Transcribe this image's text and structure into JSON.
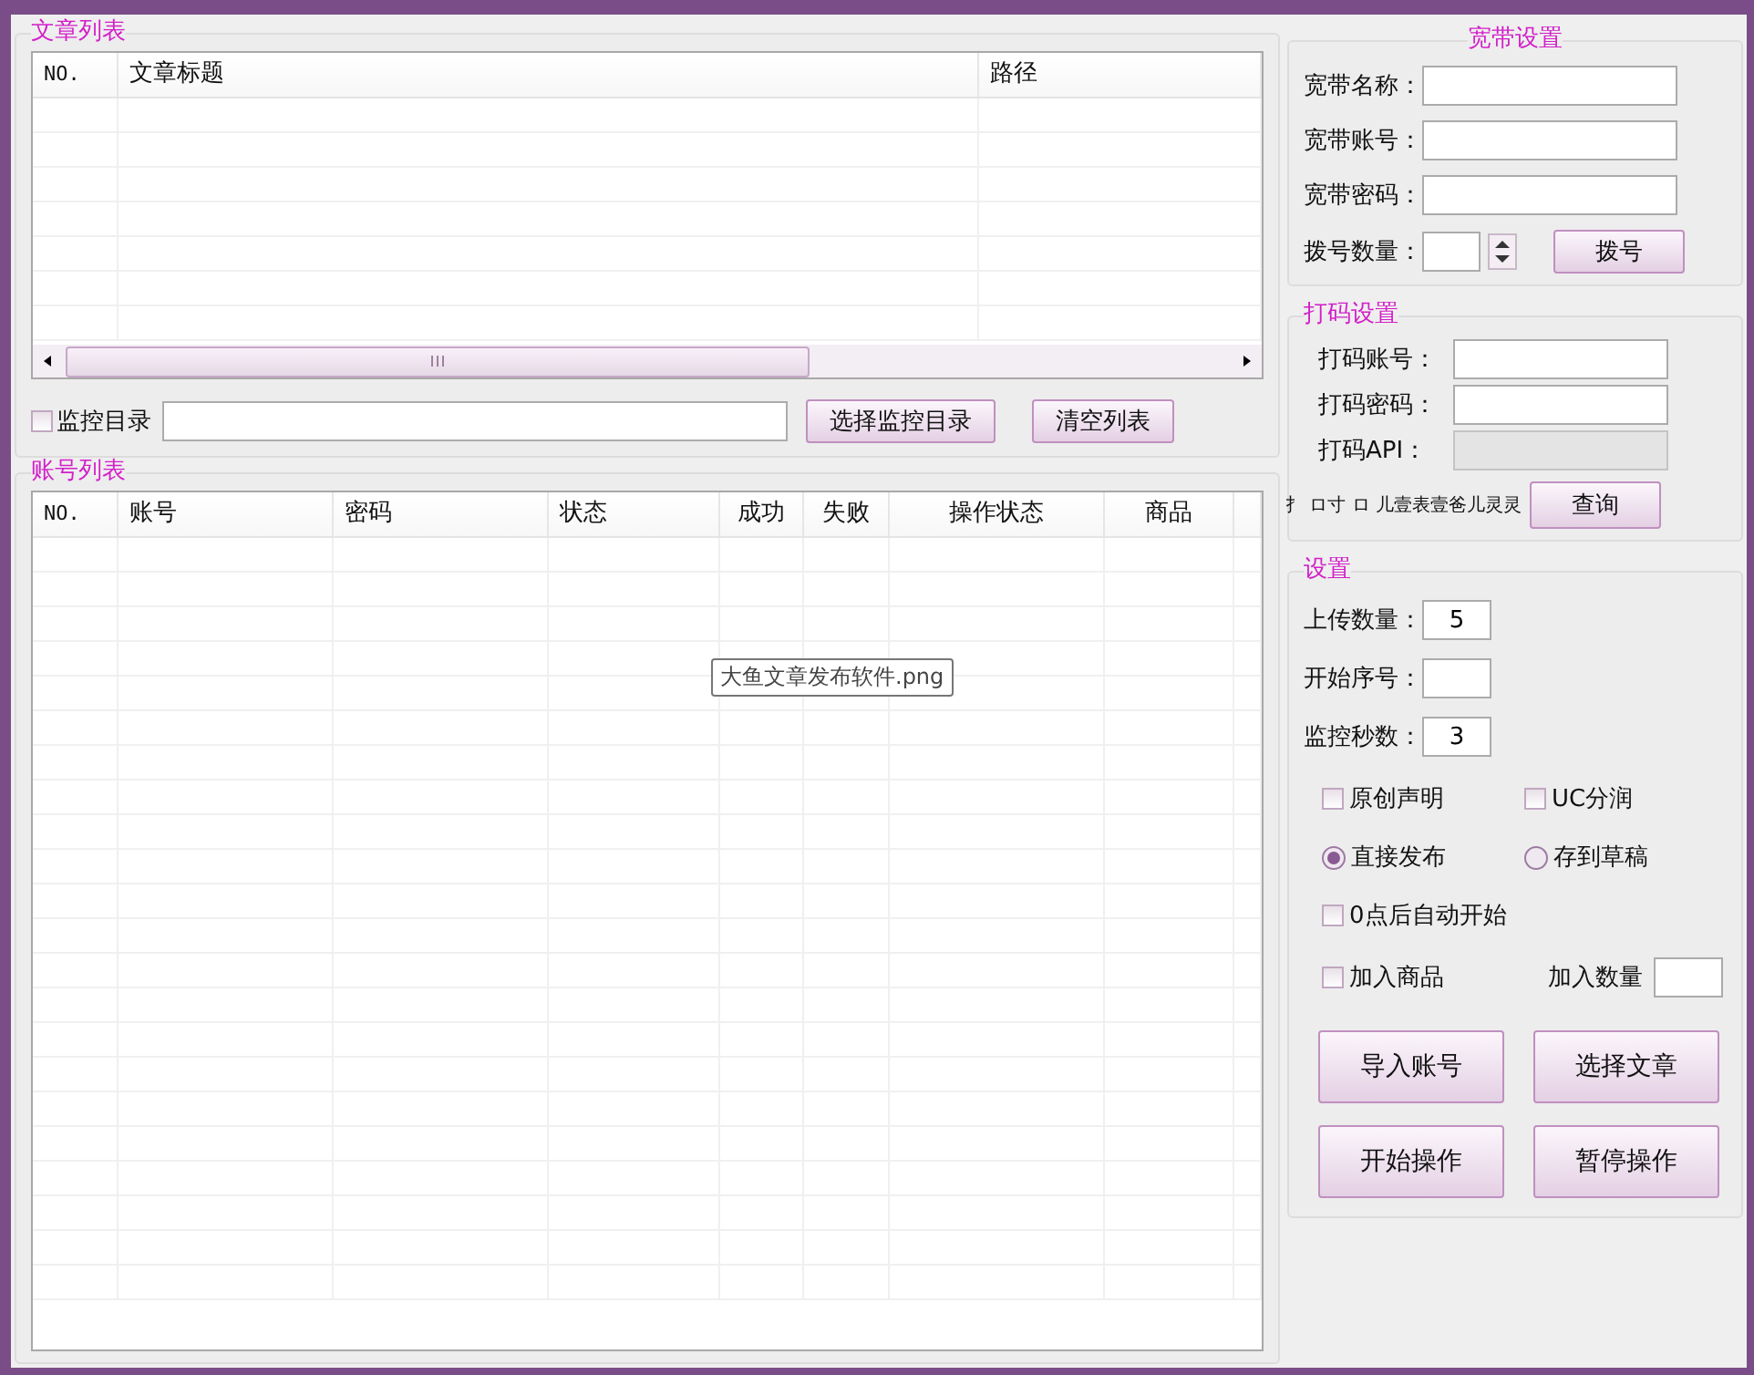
{
  "article_list": {
    "title": "文章列表",
    "columns": [
      "NO.",
      "文章标题",
      "路径"
    ]
  },
  "monitor": {
    "label": "监控目录",
    "checked": false,
    "select_button": "选择监控目录",
    "clear_button": "清空列表"
  },
  "account_list": {
    "title": "账号列表",
    "columns": [
      "NO.",
      "账号",
      "密码",
      "状态",
      "成功",
      "失败",
      "操作状态",
      "商品"
    ]
  },
  "tooltip": "大鱼文章发布软件.png",
  "broadband": {
    "title": "宽带设置",
    "fields": [
      {
        "label": "宽带名称："
      },
      {
        "label": "宽带账号："
      },
      {
        "label": "宽带密码："
      }
    ],
    "dial_count_label": "拨号数量：",
    "dial_button": "拨号"
  },
  "captcha": {
    "title": "打码设置",
    "fields": [
      {
        "label": "打码账号：",
        "disabled": false
      },
      {
        "label": "打码密码：",
        "disabled": false
      },
      {
        "label": "打码API：",
        "disabled": true
      }
    ],
    "balance": "扌 ロ寸 ロ 儿壹表壹爸儿灵灵",
    "query_button": "查询"
  },
  "settings": {
    "title": "设置",
    "fields": [
      {
        "label": "上传数量：",
        "value": "5"
      },
      {
        "label": "开始序号："
      },
      {
        "label": "监控秒数：",
        "value": "3"
      }
    ],
    "checks": [
      {
        "label": "原创声明",
        "checked": false
      },
      {
        "label": "UC分润",
        "checked": false
      }
    ],
    "radios": [
      {
        "label": "直接发布",
        "selected": true
      },
      {
        "label": "存到草稿",
        "selected": false
      }
    ],
    "auto_start": {
      "label": "0点后自动开始",
      "checked": false
    },
    "add_goods": {
      "label": "加入商品",
      "checked": false,
      "count_label": "加入数量"
    },
    "buttons": [
      "导入账号",
      "选择文章",
      "开始操作",
      "暂停操作"
    ]
  }
}
